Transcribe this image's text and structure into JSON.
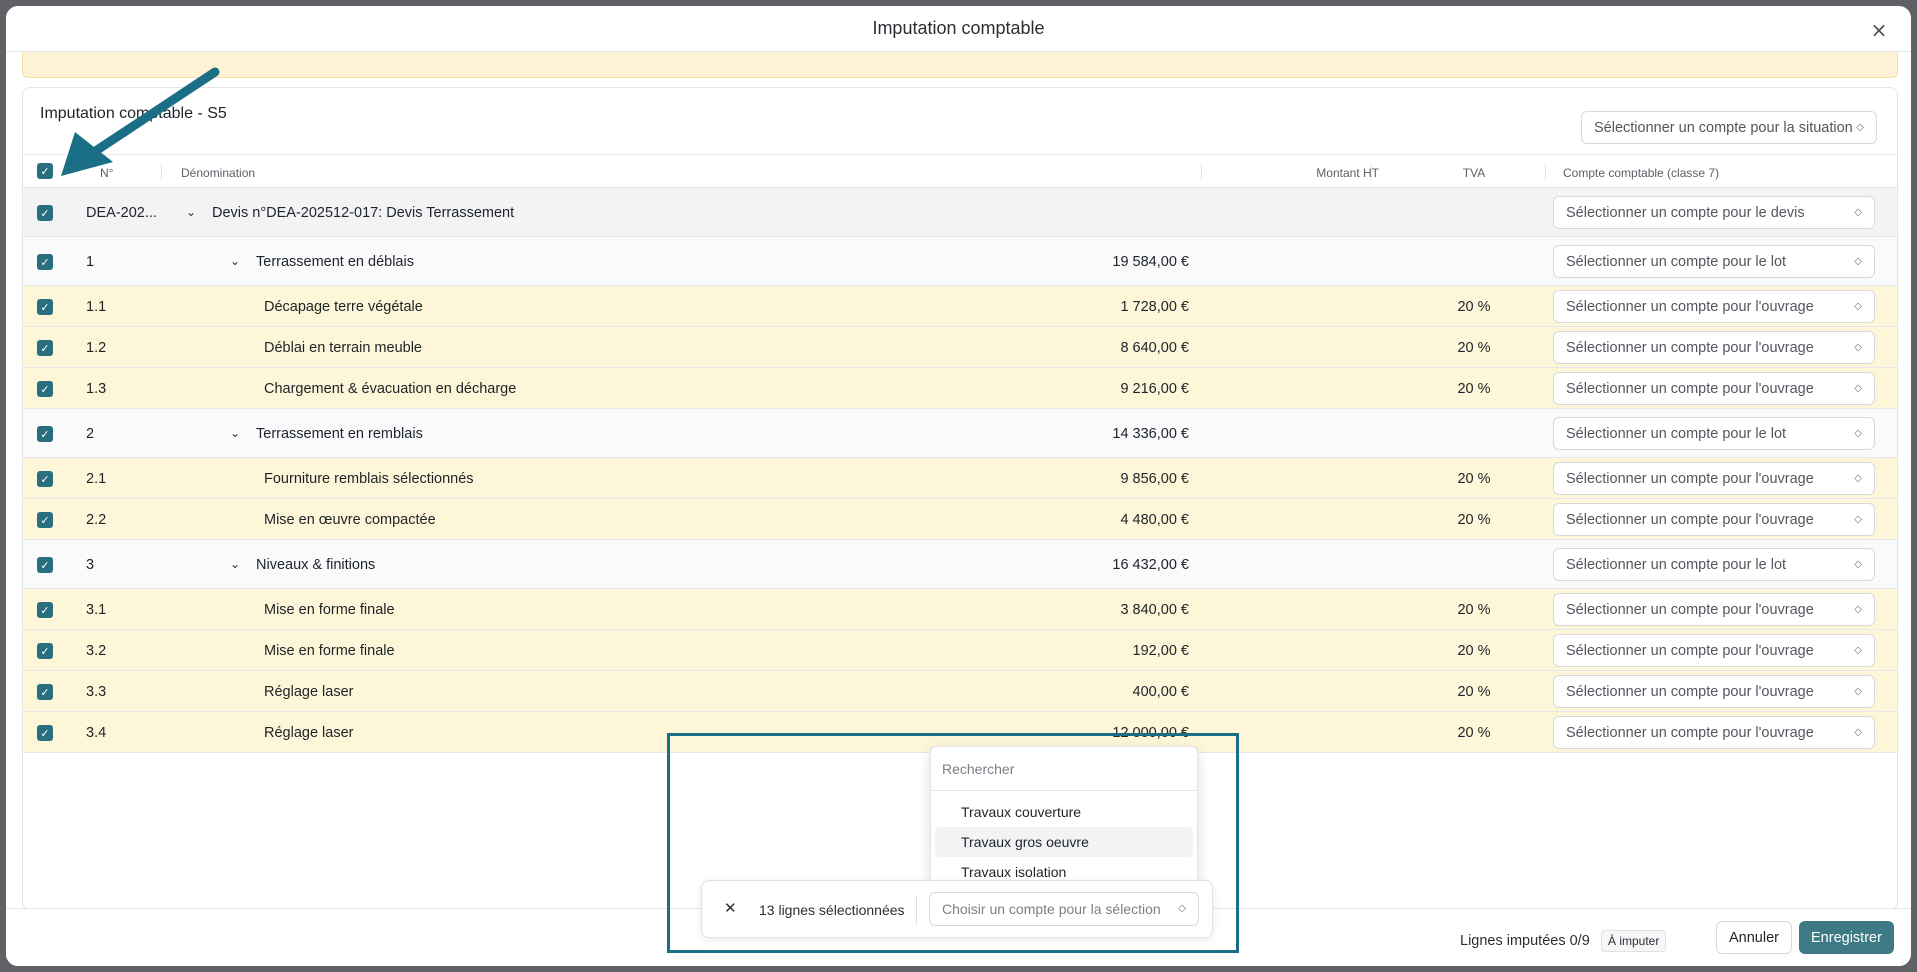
{
  "modal": {
    "title": "Imputation comptable",
    "close": "×"
  },
  "card": {
    "title": "Imputation comptable - S5",
    "situation_select": "Sélectionner un compte pour la situation"
  },
  "columns": {
    "num": "N°",
    "denomination": "Dénomination",
    "amount": "Montant HT",
    "tva": "TVA",
    "account": "Compte comptable (classe 7)"
  },
  "rows": [
    {
      "type": "devis",
      "num": "DEA-202...",
      "label": "Devis n°DEA-202512-017: Devis Terrassement",
      "amount": "",
      "tva": "",
      "select": "Sélectionner un compte pour le devis"
    },
    {
      "type": "lot",
      "num": "1",
      "label": "Terrassement en déblais",
      "amount": "19 584,00 €",
      "tva": "",
      "select": "Sélectionner un compte pour le lot"
    },
    {
      "type": "ouv",
      "num": "1.1",
      "label": "Décapage terre végétale",
      "amount": "1 728,00 €",
      "tva": "20 %",
      "select": "Sélectionner un compte pour l'ouvrage"
    },
    {
      "type": "ouv",
      "num": "1.2",
      "label": "Déblai en terrain meuble",
      "amount": "8 640,00 €",
      "tva": "20 %",
      "select": "Sélectionner un compte pour l'ouvrage"
    },
    {
      "type": "ouv",
      "num": "1.3",
      "label": "Chargement & évacuation en décharge",
      "amount": "9 216,00 €",
      "tva": "20 %",
      "select": "Sélectionner un compte pour l'ouvrage"
    },
    {
      "type": "lot",
      "num": "2",
      "label": "Terrassement en remblais",
      "amount": "14 336,00 €",
      "tva": "",
      "select": "Sélectionner un compte pour le lot"
    },
    {
      "type": "ouv",
      "num": "2.1",
      "label": "Fourniture remblais sélectionnés",
      "amount": "9 856,00 €",
      "tva": "20 %",
      "select": "Sélectionner un compte pour l'ouvrage"
    },
    {
      "type": "ouv",
      "num": "2.2",
      "label": "Mise en œuvre compactée",
      "amount": "4 480,00 €",
      "tva": "20 %",
      "select": "Sélectionner un compte pour l'ouvrage"
    },
    {
      "type": "lot",
      "num": "3",
      "label": "Niveaux & finitions",
      "amount": "16 432,00 €",
      "tva": "",
      "select": "Sélectionner un compte pour le lot"
    },
    {
      "type": "ouv",
      "num": "3.1",
      "label": "Mise en forme finale",
      "amount": "3 840,00 €",
      "tva": "20 %",
      "select": "Sélectionner un compte pour l'ouvrage"
    },
    {
      "type": "ouv",
      "num": "3.2",
      "label": "Mise en forme finale",
      "amount": "192,00 €",
      "tva": "20 %",
      "select": "Sélectionner un compte pour l'ouvrage"
    },
    {
      "type": "ouv",
      "num": "3.3",
      "label": "Réglage laser",
      "amount": "400,00 €",
      "tva": "20 %",
      "select": "Sélectionner un compte pour l'ouvrage"
    },
    {
      "type": "ouv",
      "num": "3.4",
      "label": "Réglage laser",
      "amount": "12 000,00 €",
      "tva": "20 %",
      "select": "Sélectionner un compte pour l'ouvrage"
    }
  ],
  "selection_bar": {
    "count_label": "13 lignes sélectionnées",
    "choose_placeholder": "Choisir un compte pour la sélection"
  },
  "dropdown": {
    "search_placeholder": "Rechercher",
    "options": [
      "Travaux couverture",
      "Travaux gros oeuvre",
      "Travaux isolation"
    ]
  },
  "footer": {
    "imputed": "Lignes imputées 0/9",
    "badge": "À imputer",
    "cancel": "Annuler",
    "save": "Enregistrer"
  },
  "colors": {
    "primary": "#3d7a86",
    "checkbox": "#2a6f7d",
    "ouvrage_row": "#fdf6d8",
    "annotation": "#1a6e85"
  },
  "icons": {
    "close": "close-icon",
    "chevron": "chevron-updown-icon",
    "expand": "chevron-down-icon",
    "check": "check-icon"
  }
}
